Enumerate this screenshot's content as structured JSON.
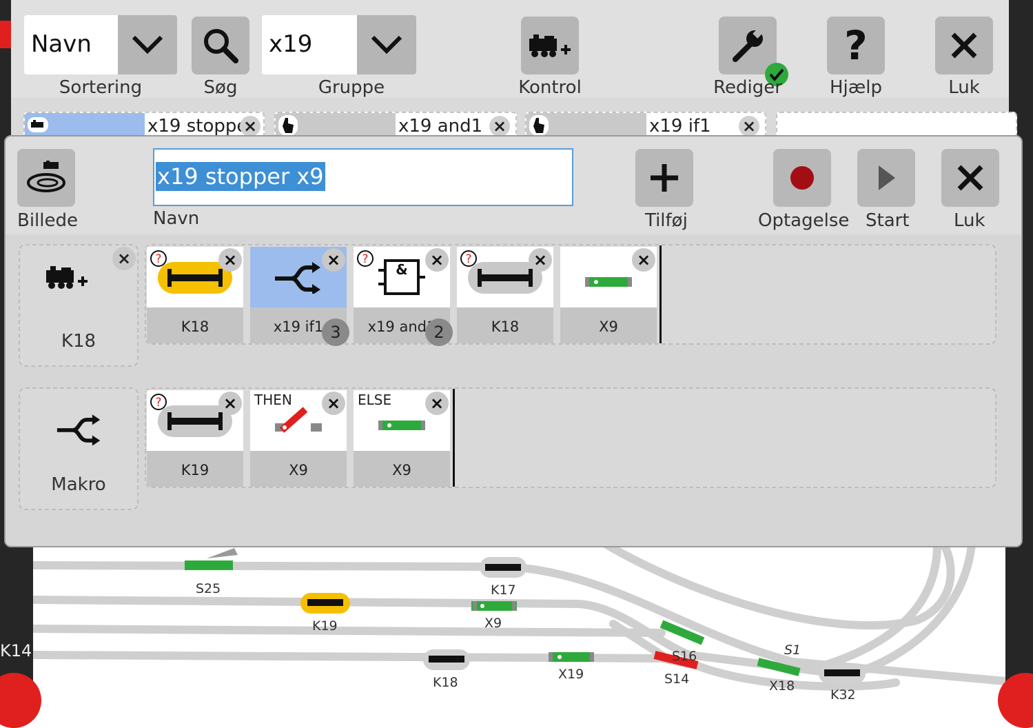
{
  "topbar": {
    "sort": {
      "value": "Navn",
      "label": "Sortering"
    },
    "search_label": "Søg",
    "group": {
      "value": "x19",
      "label": "Gruppe"
    },
    "control_label": "Kontrol",
    "edit_label": "Rediger",
    "help_label": "Hjælp",
    "close_label": "Luk",
    "chips": [
      {
        "text": "x19 stoppe"
      },
      {
        "text": "x19 and1"
      },
      {
        "text": "x19 if1"
      }
    ]
  },
  "dialog": {
    "image_label": "Billede",
    "name_value": "x19 stopper x9",
    "name_label": "Navn",
    "add_label": "Tilføj",
    "record_label": "Optagelse",
    "start_label": "Start",
    "close_label": "Luk",
    "rows": [
      {
        "slot_label": "K18",
        "cards": [
          {
            "label": "K18"
          },
          {
            "label": "x19 if1",
            "badge": "3"
          },
          {
            "label": "x19 and1",
            "badge": "2"
          },
          {
            "label": "K18"
          },
          {
            "label": "X9"
          }
        ]
      },
      {
        "slot_label": "Makro",
        "cards": [
          {
            "label": "K19"
          },
          {
            "label": "X9",
            "tag": "THEN"
          },
          {
            "label": "X9",
            "tag": "ELSE"
          }
        ]
      }
    ]
  },
  "track_labels": [
    "S25",
    "K17",
    "K19",
    "X9",
    "S16",
    "S1",
    "K18",
    "X19",
    "S14",
    "X18",
    "K32",
    "K14"
  ],
  "colors": {
    "accent_blue": "#3d8fd6",
    "green": "#2eaa3c",
    "red": "#e0201e",
    "yellow": "#f5c000",
    "button_gray": "#b5b5b5"
  }
}
